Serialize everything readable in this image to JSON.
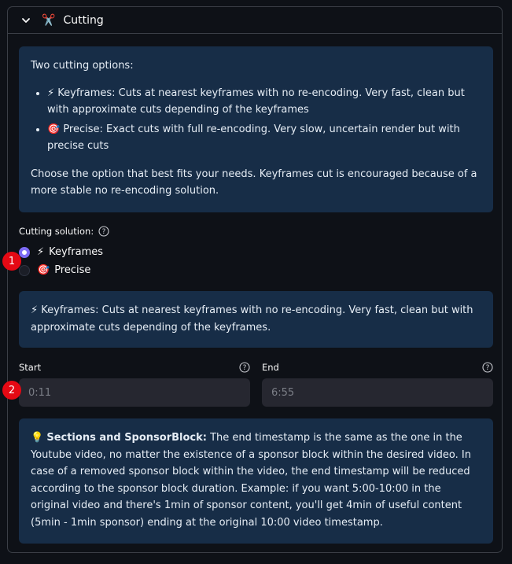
{
  "expander": {
    "emoji": "✂️",
    "title": "Cutting"
  },
  "info_top": {
    "intro": "Two cutting options:",
    "bullets": [
      "⚡ Keyframes: Cuts at nearest keyframes with no re-encoding. Very fast, clean but with approximate cuts depending of the keyframes",
      "🎯 Precise: Exact cuts with full re-encoding. Very slow, uncertain render but with precise cuts"
    ],
    "outro": "Choose the option that best fits your needs. Keyframes cut is encouraged because of a more stable no re-encoding solution."
  },
  "radio": {
    "label": "Cutting solution:",
    "options": [
      {
        "emoji": "⚡",
        "label": "Keyframes",
        "selected": true
      },
      {
        "emoji": "🎯",
        "label": "Precise",
        "selected": false
      }
    ]
  },
  "info_selected": {
    "text": "⚡ Keyframes: Cuts at nearest keyframes with no re-encoding. Very fast, clean but with approximate cuts depending of the keyframes."
  },
  "start": {
    "label": "Start",
    "placeholder": "0:11"
  },
  "end": {
    "label": "End",
    "placeholder": "6:55"
  },
  "info_bottom": {
    "emoji": "💡",
    "bold": "Sections and SponsorBlock:",
    "text": " The end timestamp is the same as the one in the Youtube video, no matter the existence of a sponsor block within the desired video. In case of a removed sponsor block within the video, the end timestamp will be reduced according to the sponsor block duration. Example: if you want 5:00-10:00 in the original video and there's 1min of sponsor content, you'll get 4min of useful content (5min - 1min sponsor) ending at the original 10:00 video timestamp."
  },
  "markers": [
    "1",
    "2"
  ],
  "colors": {
    "background": "#0e1117",
    "info_bg": "#172d47",
    "radio_accent": "#7e6cf5",
    "input_bg": "#262730",
    "marker": "#e50914"
  }
}
